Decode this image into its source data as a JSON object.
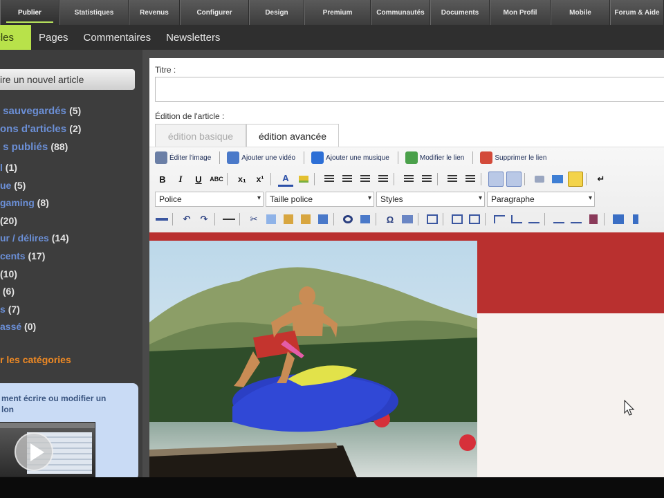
{
  "topnav": {
    "items": [
      {
        "label": "Publier",
        "active": true
      },
      {
        "label": "Statistiques"
      },
      {
        "label": "Revenus"
      },
      {
        "label": "Configurer"
      },
      {
        "label": "Design"
      },
      {
        "label": "Premium"
      },
      {
        "label": "Communautés"
      },
      {
        "label": "Documents"
      },
      {
        "label": "Mon Profil"
      },
      {
        "label": "Mobile"
      },
      {
        "label": "Forum & Aide"
      }
    ]
  },
  "subnav": {
    "items": [
      {
        "label": "icles",
        "active": true
      },
      {
        "label": "Pages"
      },
      {
        "label": "Commentaires"
      },
      {
        "label": "Newsletters"
      }
    ]
  },
  "sidebar": {
    "new_article_button": "ire un nouvel article",
    "status_rows": [
      {
        "label": "sauvegardés",
        "count": "(5)"
      },
      {
        "label": "ons d'articles",
        "count": "(2)"
      },
      {
        "label": "s publiés",
        "count": "(88)"
      }
    ],
    "categories": [
      {
        "label": "l",
        "count": "(1)"
      },
      {
        "label": "ue",
        "count": "(5)"
      },
      {
        "label": "gaming",
        "count": "(8)"
      },
      {
        "label": "",
        "count": "(20)"
      },
      {
        "label": "ur / délires",
        "count": "(14)"
      },
      {
        "label": "cents",
        "count": "(17)"
      },
      {
        "label": "",
        "count": "(10)"
      },
      {
        "label": "",
        "count": "(6)"
      },
      {
        "label": "s",
        "count": "(7)"
      },
      {
        "label": "assé",
        "count": "(0)"
      }
    ],
    "see_categories": "r les catégories",
    "help_text": "ment écrire ou modifier un\nlon"
  },
  "editor": {
    "title_label": "Titre :",
    "title_value": "",
    "edit_label": "Édition de l'article :",
    "tabs": [
      {
        "label": "édition basique",
        "active": false
      },
      {
        "label": "édition avancée",
        "active": true
      }
    ],
    "toolbar_row1": [
      {
        "label": "Éditer l'image",
        "icon": "edit-image-icon"
      },
      {
        "label": "Ajouter une vidéo",
        "icon": "video-icon"
      },
      {
        "label": "Ajouter une musique",
        "icon": "music-icon"
      },
      {
        "label": "Modifier le lien",
        "icon": "edit-link-icon"
      },
      {
        "label": "Supprimer le lien",
        "icon": "unlink-icon"
      }
    ],
    "format_buttons": {
      "bold": "B",
      "italic": "I",
      "underline": "U",
      "strike": "ABC",
      "subscript": "x₁",
      "superscript": "x¹",
      "text_color": "A",
      "enter": "↵"
    },
    "selects": {
      "font": "Police",
      "size": "Taille police",
      "styles": "Styles",
      "paragraph": "Paragraphe"
    },
    "toolbar_row4_glyphs": {
      "undo": "↶",
      "redo": "↷",
      "cut": "✂",
      "find": "🔍",
      "omega": "Ω"
    }
  },
  "colors": {
    "accent": "#b8e24a",
    "link": "#6b8fd6",
    "orange": "#f08a24",
    "banner_red": "#b9302f"
  }
}
